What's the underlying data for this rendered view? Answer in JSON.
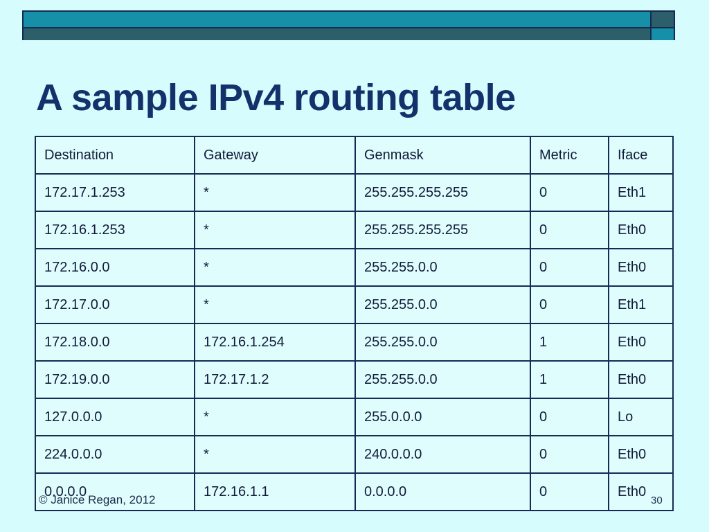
{
  "slide": {
    "title": "A sample IPv4 routing table",
    "footer_copyright": "© Janice Regan, 2012",
    "slide_number": "30"
  },
  "theme": {
    "background": "#d6fcfd",
    "title_color": "#13326b",
    "banner_teal": "#1590a8",
    "banner_dark": "#2d5f6a",
    "border_color": "#152b55",
    "cell_background": "#e0fdfe"
  },
  "table": {
    "headers": [
      "Destination",
      "Gateway",
      "Genmask",
      "Metric",
      "Iface"
    ],
    "rows": [
      {
        "destination": "172.17.1.253",
        "gateway": "*",
        "genmask": "255.255.255.255",
        "metric": "0",
        "iface": "Eth1"
      },
      {
        "destination": "172.16.1.253",
        "gateway": "*",
        "genmask": "255.255.255.255",
        "metric": "0",
        "iface": "Eth0"
      },
      {
        "destination": "172.16.0.0",
        "gateway": "*",
        "genmask": "255.255.0.0",
        "metric": "0",
        "iface": "Eth0"
      },
      {
        "destination": "172.17.0.0",
        "gateway": "*",
        "genmask": "255.255.0.0",
        "metric": "0",
        "iface": "Eth1"
      },
      {
        "destination": "172.18.0.0",
        "gateway": "172.16.1.254",
        "genmask": "255.255.0.0",
        "metric": "1",
        "iface": "Eth0"
      },
      {
        "destination": "172.19.0.0",
        "gateway": "172.17.1.2",
        "genmask": "255.255.0.0",
        "metric": "1",
        "iface": "Eth0"
      },
      {
        "destination": "127.0.0.0",
        "gateway": "*",
        "genmask": "255.0.0.0",
        "metric": "0",
        "iface": "Lo"
      },
      {
        "destination": "224.0.0.0",
        "gateway": "*",
        "genmask": "240.0.0.0",
        "metric": "0",
        "iface": "Eth0"
      },
      {
        "destination": "0.0.0.0",
        "gateway": "172.16.1.1",
        "genmask": "0.0.0.0",
        "metric": "0",
        "iface": "Eth0"
      }
    ]
  }
}
